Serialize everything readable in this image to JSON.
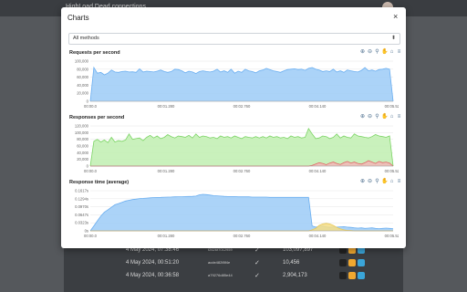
{
  "header": {
    "brand": "HighLoad   Dead connections"
  },
  "background_table": {
    "rows": [
      {
        "date": "4 May 2024, 07:38:46",
        "hash": "f2626f7012959",
        "value": "103,097,897",
        "c1": "#f0a830",
        "c2": "#3aa5d9"
      },
      {
        "date": "4 May 2024, 00:51:20",
        "hash": "acde482f8f4e",
        "value": "10,456",
        "c1": "#f0a830",
        "c2": "#3aa5d9"
      },
      {
        "date": "4 May 2024, 00:36:58",
        "hash": "a79276d85e44",
        "value": "2,904,173",
        "c1": "#f0a830",
        "c2": "#3aa5d9"
      }
    ]
  },
  "modal": {
    "title": "Charts",
    "close": "×",
    "method_select": "All methods",
    "toolbar_icons": [
      "zoom-in-icon",
      "zoom-out-icon",
      "magnifier-icon",
      "pan-icon",
      "home-icon",
      "menu-icon"
    ]
  },
  "charts": [
    {
      "title": "Requests per second",
      "type": "area",
      "ylabels": [
        "100,000",
        "80,000",
        "60,000",
        "40,000",
        "20,000",
        "0"
      ],
      "ylim": [
        0,
        100000
      ],
      "xlabels": [
        "00:00.0",
        "00:01.280",
        "00:02.760",
        "00:04.140",
        "00:05.520"
      ],
      "series": [
        {
          "color": "#6aaef0",
          "fill": "#9ccbf7",
          "values": [
            0,
            84000,
            70000,
            72000,
            66000,
            70000,
            78000,
            73000,
            72000,
            74000,
            75000,
            73000,
            73500,
            72000,
            81000,
            73000,
            75000,
            74000,
            73000,
            75000,
            78000,
            74000,
            72000,
            74000,
            80000,
            79000,
            76000,
            71000,
            75000,
            73000,
            69000,
            74000,
            76000,
            74000,
            73000,
            75000,
            80000,
            73000,
            76000,
            72000,
            80000,
            70000,
            75000,
            72000,
            80000,
            76000,
            74000,
            71000,
            76000,
            78000,
            82000,
            79000,
            76000,
            74000,
            72000,
            76000,
            79000,
            80000,
            81000,
            79000,
            80000,
            77000,
            82000,
            84000,
            80000,
            78000,
            74000,
            76000,
            74000,
            80000,
            73000,
            76000,
            72000,
            78000,
            76000,
            74000,
            73000,
            77000,
            84000,
            76000,
            78000,
            75000,
            79000,
            80000,
            82000,
            80000,
            0
          ]
        }
      ]
    },
    {
      "title": "Responses per second",
      "type": "area",
      "ylabels": [
        "120,000",
        "100,000",
        "80,000",
        "60,000",
        "40,000",
        "20,000",
        "0"
      ],
      "ylim": [
        0,
        120000
      ],
      "xlabels": [
        "00:00.0",
        "00:01.280",
        "00:02.760",
        "00:04.140",
        "00:05.520"
      ],
      "series": [
        {
          "color": "#7cd465",
          "fill": "#bfeeb0",
          "values": [
            0,
            74000,
            80000,
            72000,
            78000,
            70000,
            86000,
            72000,
            76000,
            74000,
            78000,
            96000,
            80000,
            82000,
            84000,
            76000,
            86000,
            92000,
            84000,
            90000,
            82000,
            86000,
            94000,
            88000,
            84000,
            90000,
            88000,
            86000,
            92000,
            84000,
            96000,
            86000,
            90000,
            88000,
            84000,
            86000,
            82000,
            90000,
            86000,
            88000,
            84000,
            90000,
            86000,
            82000,
            88000,
            86000,
            84000,
            88000,
            84000,
            88000,
            84000,
            90000,
            86000,
            88000,
            84000,
            86000,
            82000,
            90000,
            86000,
            88000,
            84000,
            86000,
            112000,
            96000,
            82000,
            84000,
            90000,
            88000,
            82000,
            86000,
            96000,
            84000,
            90000,
            86000,
            84000,
            96000,
            90000,
            88000,
            86000,
            84000,
            88000,
            94000,
            90000,
            88000,
            86000,
            90000,
            0
          ]
        },
        {
          "color": "#e06767",
          "fill": "#f2b7b7",
          "values": [
            0,
            0,
            0,
            0,
            0,
            0,
            0,
            0,
            0,
            0,
            0,
            0,
            0,
            0,
            0,
            0,
            0,
            0,
            0,
            0,
            0,
            0,
            0,
            0,
            0,
            0,
            0,
            0,
            0,
            0,
            0,
            0,
            0,
            0,
            0,
            0,
            0,
            0,
            0,
            0,
            0,
            0,
            0,
            0,
            0,
            0,
            0,
            0,
            0,
            0,
            0,
            0,
            0,
            0,
            0,
            0,
            0,
            0,
            0,
            0,
            0,
            0,
            0,
            2000,
            6000,
            10000,
            8000,
            4000,
            9000,
            12000,
            8000,
            5000,
            10000,
            14000,
            9000,
            12000,
            8000,
            6000,
            10000,
            16000,
            12000,
            8000,
            14000,
            10000,
            12000,
            9000,
            0
          ]
        }
      ]
    },
    {
      "title": "Response time (average)",
      "type": "area",
      "ylabels": [
        "0.1617s",
        "0.1294s",
        "0.0970s",
        "0.0647s",
        "0.0323s",
        "0s"
      ],
      "ylim": [
        0,
        0.1617
      ],
      "xlabels": [
        "00:00.0",
        "00:01.280",
        "00:02.760",
        "00:04.140",
        "00:05.520"
      ],
      "series": [
        {
          "color": "#6aaef0",
          "fill": "#9ccbf7",
          "values": [
            0,
            0.02,
            0.04,
            0.06,
            0.075,
            0.085,
            0.095,
            0.105,
            0.11,
            0.115,
            0.12,
            0.123,
            0.126,
            0.128,
            0.13,
            0.131,
            0.132,
            0.133,
            0.134,
            0.1345,
            0.135,
            0.1355,
            0.136,
            0.1365,
            0.137,
            0.1373,
            0.1376,
            0.138,
            0.1385,
            0.139,
            0.14,
            0.145,
            0.147,
            0.146,
            0.144,
            0.142,
            0.141,
            0.14,
            0.139,
            0.138,
            0.138,
            0.138,
            0.137,
            0.137,
            0.137,
            0.137,
            0.136,
            0.136,
            0.136,
            0.136,
            0.136,
            0.135,
            0.135,
            0.135,
            0.135,
            0.135,
            0.135,
            0.135,
            0.135,
            0.135,
            0.135,
            0.135,
            0.135,
            0.02,
            0.015,
            0.018,
            0.02,
            0.016,
            0.014,
            0.016,
            0.015,
            0.016,
            0.017,
            0.015,
            0.014,
            0.012,
            0.011,
            0.012,
            0.01,
            0.011,
            0.012,
            0.01,
            0.009,
            0.01,
            0.011,
            0.01,
            0.009
          ]
        },
        {
          "color": "#e8c95a",
          "fill": "#f5dd86",
          "values": [
            0,
            0,
            0,
            0,
            0,
            0,
            0,
            0,
            0,
            0,
            0,
            0,
            0,
            0,
            0,
            0,
            0,
            0,
            0,
            0,
            0,
            0,
            0,
            0,
            0,
            0,
            0,
            0,
            0,
            0,
            0,
            0,
            0,
            0,
            0,
            0,
            0,
            0,
            0,
            0,
            0,
            0,
            0,
            0,
            0,
            0,
            0,
            0,
            0,
            0,
            0,
            0,
            0,
            0,
            0,
            0,
            0,
            0,
            0,
            0,
            0,
            0,
            0,
            0.004,
            0.01,
            0.022,
            0.028,
            0.03,
            0.028,
            0.022,
            0.014,
            0.008,
            0.004,
            0.002,
            0.001,
            0,
            0,
            0,
            0,
            0,
            0,
            0,
            0,
            0,
            0,
            0,
            0
          ]
        }
      ]
    }
  ]
}
